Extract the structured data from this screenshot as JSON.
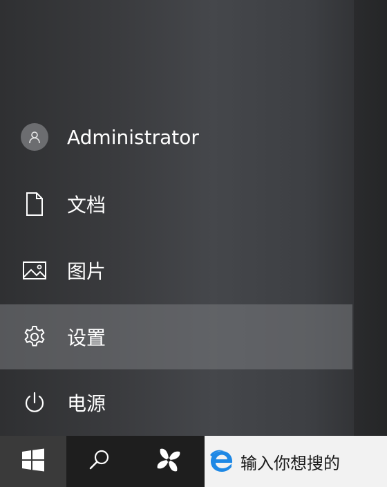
{
  "start_menu": {
    "items": [
      {
        "label": "Administrator",
        "icon": "user-avatar-icon"
      },
      {
        "label": "文档",
        "icon": "document-icon"
      },
      {
        "label": "图片",
        "icon": "pictures-icon"
      },
      {
        "label": "设置",
        "icon": "gear-icon",
        "highlighted": true
      },
      {
        "label": "电源",
        "icon": "power-icon"
      }
    ]
  },
  "taskbar": {
    "start_icon": "windows-logo-icon",
    "search_icon": "search-icon",
    "app_icon": "pinwheel-app-icon",
    "search_box": {
      "icon": "edge-icon",
      "placeholder": "输入你想搜的"
    }
  },
  "colors": {
    "highlight": "#7a7c80",
    "taskbar": "#1e1e1e",
    "start_button": "#3a3a3a",
    "edge_blue": "#1e88e5"
  }
}
